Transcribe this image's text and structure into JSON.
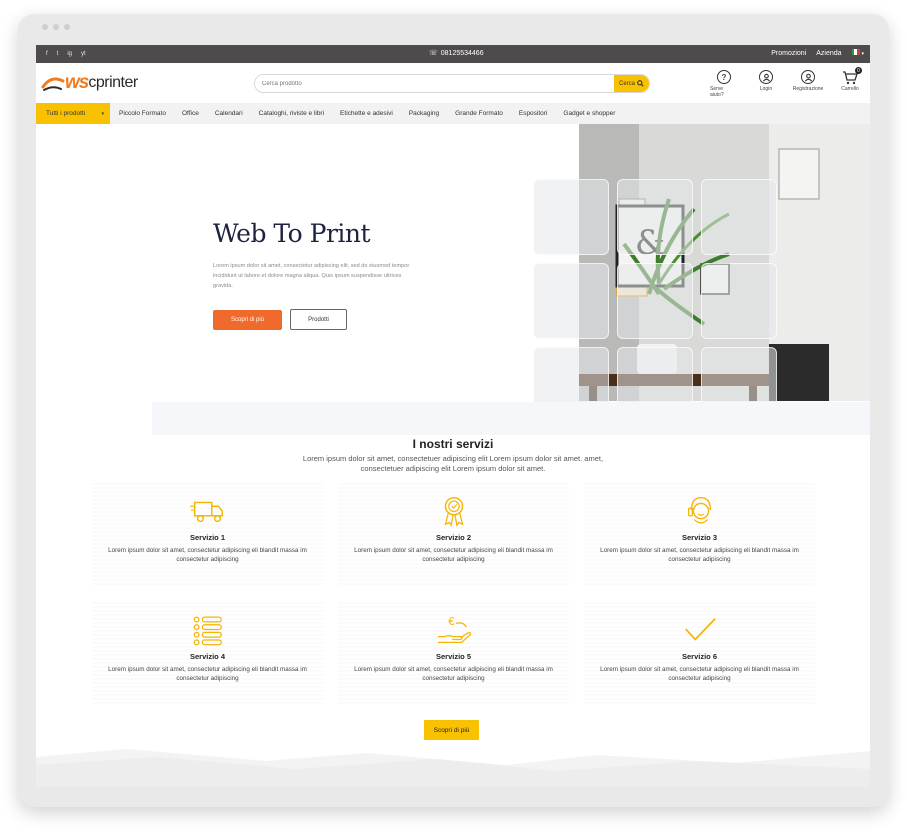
{
  "topbar": {
    "socials": [
      "f",
      "t",
      "ig",
      "yt"
    ],
    "phone": "08125534466",
    "links": [
      "Promozioni",
      "Azienda"
    ],
    "flag_colors": [
      "#2e9b49",
      "#ffffff",
      "#d83a3a"
    ]
  },
  "header": {
    "logo_mark": "ws",
    "logo_text": "cprinter",
    "search_placeholder": "Cerca prodotto",
    "search_button": "Cerca",
    "icons": [
      {
        "glyph": "?",
        "label": "Serve aiuto?"
      },
      {
        "glyph": "●",
        "label": "Login"
      },
      {
        "glyph": "+",
        "label": "Registrazione"
      },
      {
        "glyph": "🛒",
        "label": "Carrello",
        "badge": "0"
      }
    ]
  },
  "nav": {
    "all": "Tutti i prodotti",
    "items": [
      "Piccolo Formato",
      "Office",
      "Calendari",
      "Cataloghi, riviste e libri",
      "Etichette e adesivi",
      "Packaging",
      "Grande Formato",
      "Espositori",
      "Gadget e shopper"
    ]
  },
  "hero": {
    "title": "Web To Print",
    "description": "Lorem ipsum dolor sit amet, consectetur adipiscing elit, sed do eiusmod tempor incididunt ut labore et dolore magna aliqua. Quis ipsum suspendisse ultrices gravida.",
    "primary_button": "Scopri di più",
    "secondary_button": "Prodotti"
  },
  "services": {
    "title": "I nostri servizi",
    "subtitle": "Lorem ipsum dolor sit amet, consectetuer adipiscing elit Lorem ipsum dolor sit amet. amet, consectetuer adipiscing elit Lorem ipsum dolor sit amet.",
    "items": [
      {
        "title": "Servizio 1",
        "icon": "truck-icon",
        "desc": "Lorem ipsum dolor sit amet, consectetur adipiscing eli blandit massa im consectetur adipiscing"
      },
      {
        "title": "Servizio 2",
        "icon": "award-icon",
        "desc": "Lorem ipsum dolor sit amet, consectetur adipiscing eli blandit massa im consectetur adipiscing"
      },
      {
        "title": "Servizio 3",
        "icon": "support-icon",
        "desc": "Lorem ipsum dolor sit amet, consectetur adipiscing eli blandit massa im consectetur adipiscing"
      },
      {
        "title": "Servizio 4",
        "icon": "list-icon",
        "desc": "Lorem ipsum dolor sit amet, consectetur adipiscing eli blandit massa im consectetur adipiscing"
      },
      {
        "title": "Servizio 5",
        "icon": "euro-hand-icon",
        "desc": "Lorem ipsum dolor sit amet, consectetur adipiscing eli blandit massa im consectetur adipiscing"
      },
      {
        "title": "Servizio 6",
        "icon": "check-icon",
        "desc": "Lorem ipsum dolor sit amet, consectetur adipiscing eli blandit massa im consectetur adipiscing"
      }
    ],
    "more_button": "Scopri di più"
  },
  "colors": {
    "accent": "#f9c200",
    "orange": "#f06b2b",
    "topbar": "#4e4b4c",
    "title": "#1e2340"
  }
}
